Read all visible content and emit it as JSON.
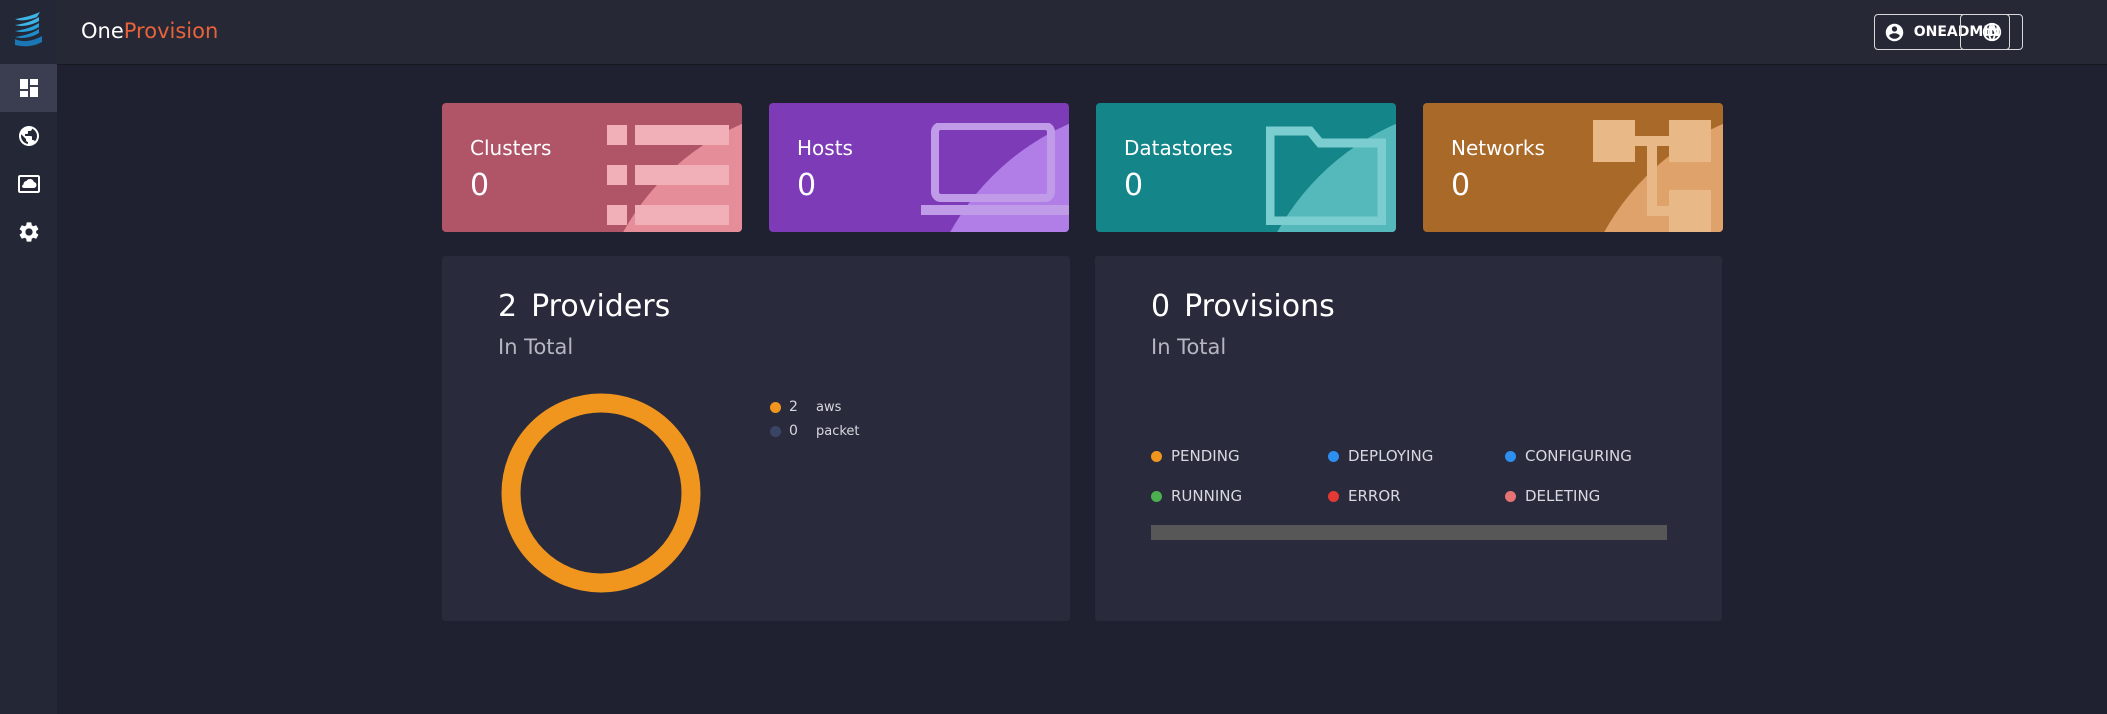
{
  "app": {
    "brand_one": "One",
    "brand_two": "Provision"
  },
  "header": {
    "user_label": "ONEADMIN"
  },
  "sidebar": {
    "items": [
      {
        "icon": "dashboard-icon",
        "active": true
      },
      {
        "icon": "globe-icon",
        "active": false
      },
      {
        "icon": "cloud-image-icon",
        "active": false
      },
      {
        "icon": "gear-icon",
        "active": false
      }
    ]
  },
  "cards": {
    "clusters": {
      "label": "Clusters",
      "count": "0",
      "color": "#b05468"
    },
    "hosts": {
      "label": "Hosts",
      "count": "0",
      "color": "#7d3bb8"
    },
    "datastores": {
      "label": "Datastores",
      "count": "0",
      "color": "#14868a"
    },
    "networks": {
      "label": "Networks",
      "count": "0",
      "color": "#a96929"
    }
  },
  "providers": {
    "count": "2",
    "title": "Providers",
    "subtitle": "In Total",
    "legend": [
      {
        "value": "2",
        "name": "aws",
        "color": "#f0961e"
      },
      {
        "value": "0",
        "name": "packet",
        "color": "#3a4566"
      }
    ]
  },
  "provisions": {
    "count": "0",
    "title": "Provisions",
    "subtitle": "In Total",
    "states": [
      {
        "label": "PENDING",
        "color": "#f0961e"
      },
      {
        "label": "DEPLOYING",
        "color": "#2d8ff0"
      },
      {
        "label": "CONFIGURING",
        "color": "#2d8ff0"
      },
      {
        "label": "RUNNING",
        "color": "#4caf50"
      },
      {
        "label": "ERROR",
        "color": "#e53935"
      },
      {
        "label": "DELETING",
        "color": "#e57373"
      }
    ]
  }
}
